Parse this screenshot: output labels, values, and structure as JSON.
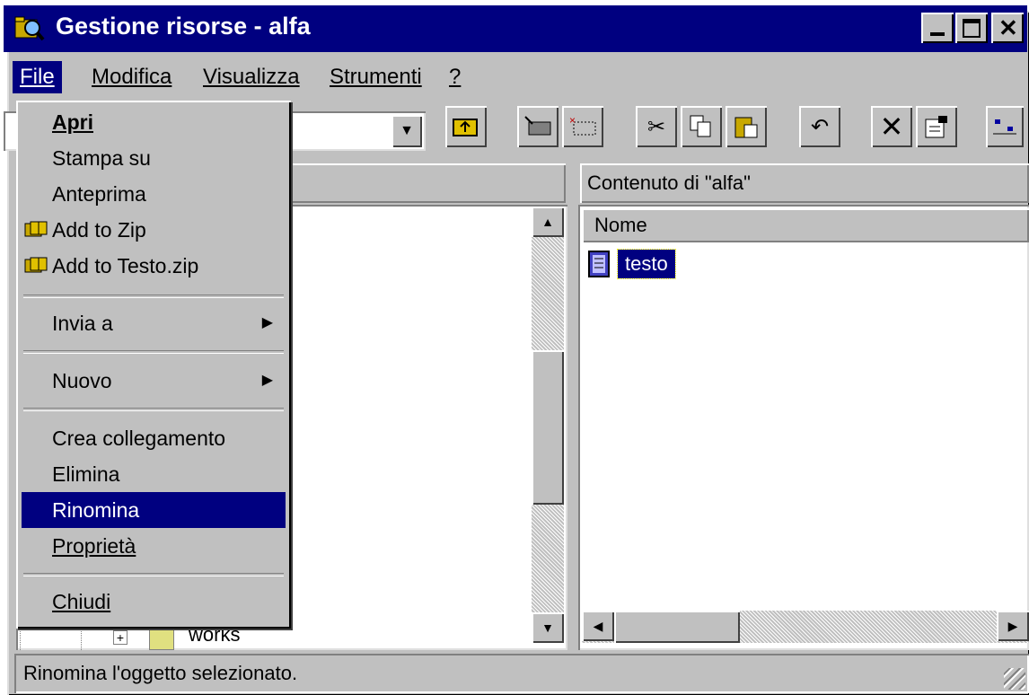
{
  "window": {
    "title": "Gestione risorse - alfa"
  },
  "titlebar": {
    "min": "_",
    "max": "☐",
    "close": "✕"
  },
  "menubar": {
    "items": [
      {
        "label": "File",
        "active": true
      },
      {
        "label": "Modifica"
      },
      {
        "label": "Visualizza"
      },
      {
        "label": "Strumenti"
      },
      {
        "label": "?"
      }
    ]
  },
  "toolbar": {
    "combo_value": ""
  },
  "left_pane": {
    "header": "",
    "visible_row": "works"
  },
  "right_pane": {
    "header": "Contenuto di \"alfa\"",
    "column_name": "Nome",
    "items": [
      {
        "name": "testo",
        "icon": "text-file-icon",
        "selected": true
      }
    ]
  },
  "file_menu": {
    "items": [
      {
        "label": "Apri",
        "bold": true
      },
      {
        "label": "Stampa su"
      },
      {
        "label": "Anteprima"
      },
      {
        "label": "Add to Zip",
        "icon": "zip-icon"
      },
      {
        "label": "Add to Testo.zip",
        "icon": "zip-icon"
      },
      {
        "label": "Invia a",
        "submenu": true
      },
      {
        "label": "Nuovo",
        "submenu": true
      },
      {
        "label": "Crea collegamento"
      },
      {
        "label": "Elimina"
      },
      {
        "label": "Rinomina",
        "selected": true
      },
      {
        "label": "Proprietà"
      },
      {
        "label": "Chiudi"
      }
    ]
  },
  "statusbar": {
    "text": "Rinomina l'oggetto selezionato."
  },
  "colors": {
    "titlebar": "#000080",
    "face": "#c0c0c0",
    "highlight": "#000080"
  }
}
